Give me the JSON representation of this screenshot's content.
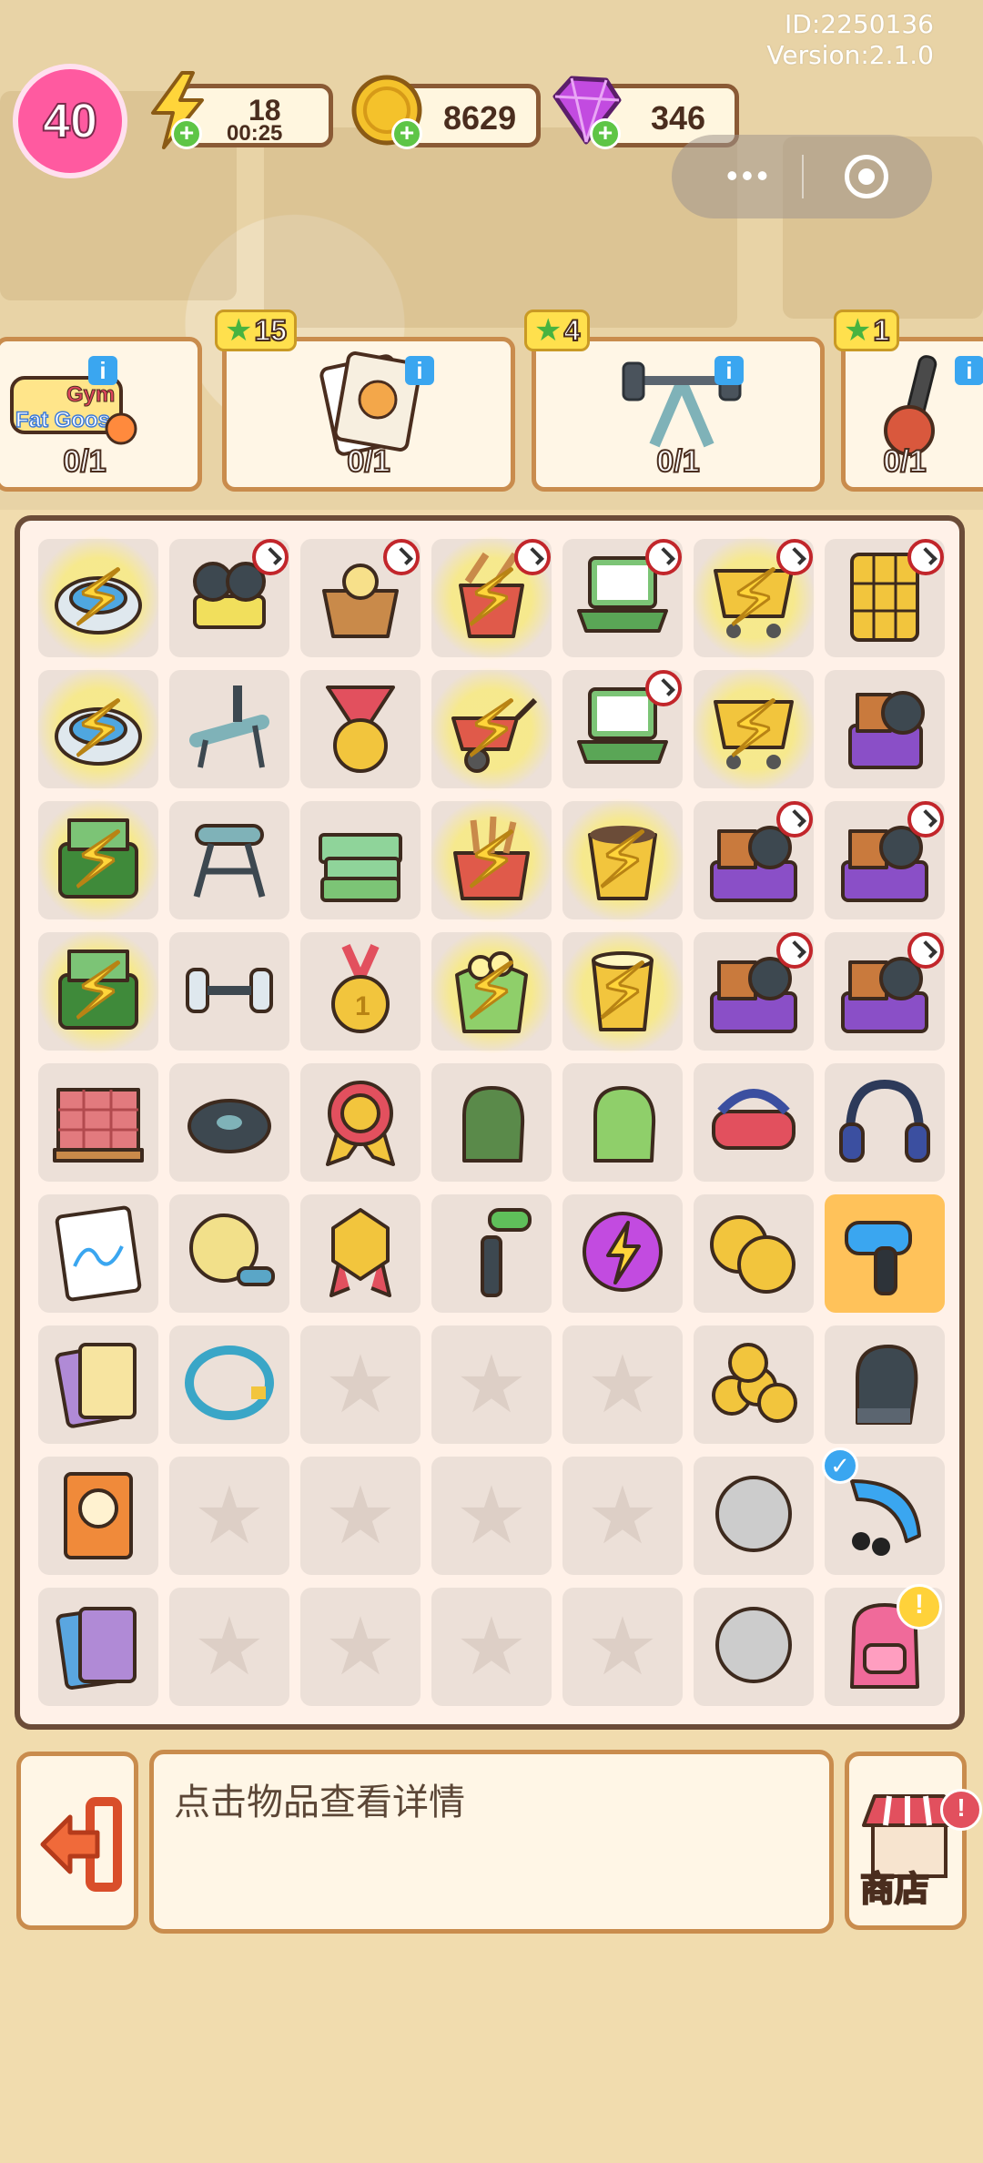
{
  "header": {
    "id_text": "ID:2250136",
    "version_text": "Version:2.1.0"
  },
  "resources": {
    "level": "40",
    "energy": "18",
    "energy_timer": "00:25",
    "coins": "8629",
    "gems": "346"
  },
  "orders": [
    {
      "name": "gym-fatgoose-order",
      "progress": "0/1",
      "stars": "",
      "logo_text": "Gym Fat Goose"
    },
    {
      "name": "photo-card-order",
      "progress": "0/1",
      "stars": "15"
    },
    {
      "name": "barbell-order",
      "progress": "0/1",
      "stars": "4"
    },
    {
      "name": "kettlebell-order",
      "progress": "0/1",
      "stars": "1"
    }
  ],
  "bottom": {
    "hint": "点击物品查看详情",
    "shop_label": "商店"
  },
  "colors": {
    "energy": "#ffd53a",
    "coin": "#f4c22b",
    "gem": "#c24be0",
    "level": "#ff5aa0",
    "board_border": "#6b4c38"
  },
  "board": [
    [
      "robot-vacuum-icon",
      "vacuum-cart-icon",
      "flower-basket-icon",
      "wheelbarrow-bucket-icon",
      "laptop-icon",
      "shopping-cart-icon",
      "locker-icon"
    ],
    [
      "robot-vacuum-icon",
      "weight-bench-icon",
      "medal-ribbon-icon",
      "wheelbarrow-icon",
      "laptop-icon",
      "shopping-cart-icon",
      "bag-box-icon"
    ],
    [
      "cash-register-icon",
      "ab-bench-icon",
      "cash-stack-icon",
      "basket-icon",
      "plant-pot-icon",
      "gift-pile-icon",
      "gift-pile-icon"
    ],
    [
      "cash-register-icon",
      "dumbbell-icon",
      "gold-medal-icon",
      "popcorn-bag-icon",
      "bucket-icon",
      "gift-pile-icon",
      "gift-pile-icon"
    ],
    [
      "brick-pallet-icon",
      "weight-plate-icon",
      "award-rosette-icon",
      "dark-glove-icon",
      "green-glove-icon",
      "vr-headset-icon",
      "headphones-icon"
    ],
    [
      "notebook-chart-icon",
      "yarn-ball-icon",
      "ribbon-badge-icon",
      "pipe-wrench-icon",
      "energy-orb-icon",
      "coins-icon",
      "massage-gun-icon"
    ],
    [
      "photo-cards-icon",
      "hula-hoop-icon",
      "empty",
      "empty",
      "empty",
      "coin-pile-icon",
      "boxing-glove-icon"
    ],
    [
      "recipe-book-icon",
      "empty",
      "empty",
      "empty",
      "empty",
      "coin-stack-icon",
      "blow-dryer-icon"
    ],
    [
      "card-pack-icon",
      "empty",
      "empty",
      "empty",
      "empty",
      "coin-stack-icon",
      "backpack-icon"
    ]
  ]
}
